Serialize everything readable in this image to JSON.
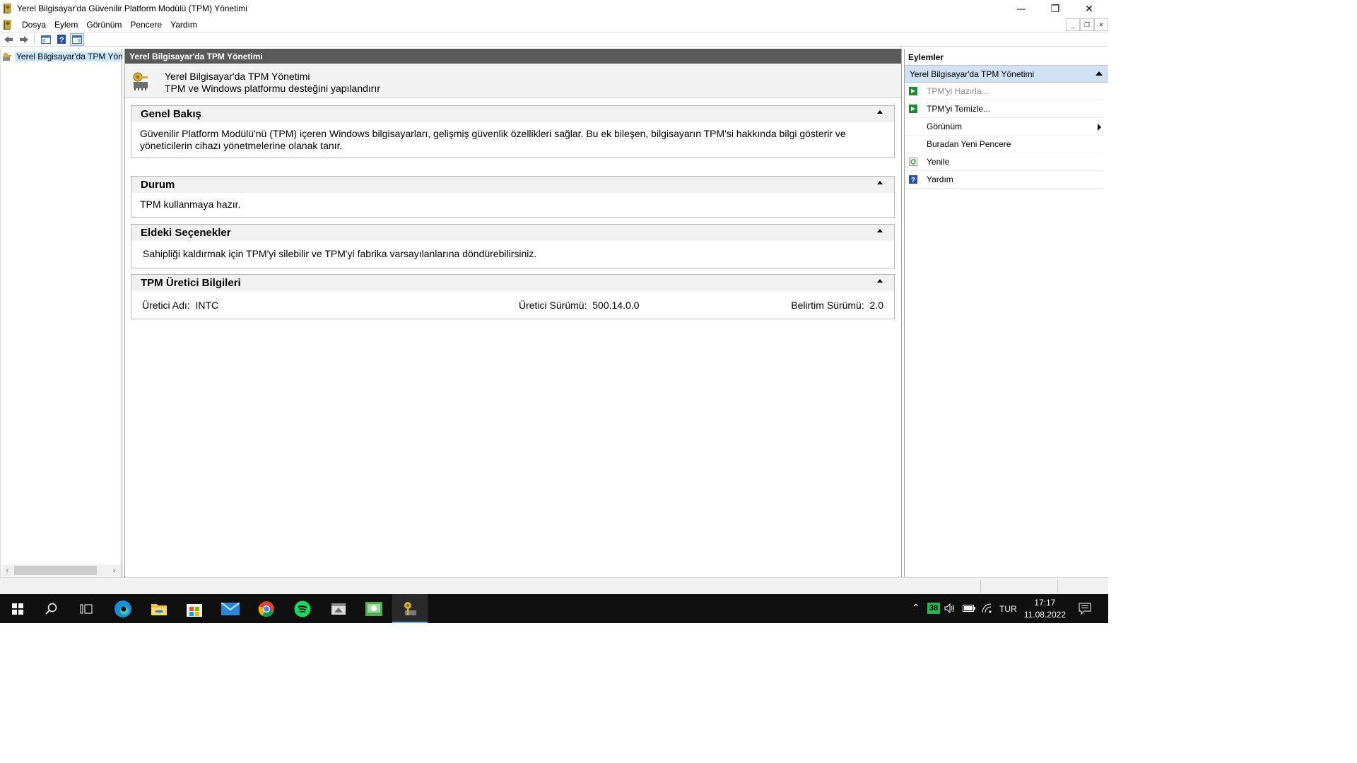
{
  "window": {
    "title": "Yerel Bilgisayar'da Güvenilir Platform Modülü (TPM) Yönetimi",
    "minimize_glyph": "—",
    "maximize_glyph": "❐",
    "close_glyph": "✕"
  },
  "menu": {
    "items": [
      "Dosya",
      "Eylem",
      "Görünüm",
      "Pencere",
      "Yardım"
    ]
  },
  "tree": {
    "root_label": "Yerel Bilgisayar'da TPM Yönetimi"
  },
  "center": {
    "header": "Yerel Bilgisayar'da TPM Yönetimi",
    "snapin_title": "Yerel Bilgisayar'da TPM Yönetimi",
    "snapin_subtitle": "TPM ve Windows platformu desteğini yapılandırır",
    "sections": {
      "overview": {
        "title": "Genel Bakış",
        "body": "Güvenilir Platform Modülü'nü (TPM) içeren Windows bilgisayarları, gelişmiş güvenlik özellikleri sağlar. Bu ek bileşen, bilgisayarın TPM'si hakkında bilgi gösterir ve yöneticilerin cihazı yönetmelerine olanak tanır."
      },
      "status": {
        "title": "Durum",
        "body": "TPM kullanmaya hazır."
      },
      "options": {
        "title": "Eldeki Seçenekler",
        "body": "Sahipliği kaldırmak için TPM'yi silebilir ve TPM'yi fabrika varsayılanlarına döndürebilirsiniz."
      },
      "manufacturer": {
        "title": "TPM Üretici Bilgileri",
        "name_label": "Üretici Adı:",
        "name_value": "INTC",
        "version_label": "Üretici Sürümü:",
        "version_value": "500.14.0.0",
        "spec_label": "Belirtim Sürümü:",
        "spec_value": "2.0"
      }
    }
  },
  "actions": {
    "title": "Eylemler",
    "group": "Yerel Bilgisayar'da TPM Yönetimi",
    "items": [
      {
        "label": "TPM'yi Hazırla...",
        "enabled": false,
        "icon": "green-arrow-icon"
      },
      {
        "label": "TPM'yi Temizle...",
        "enabled": true,
        "icon": "green-arrow-icon"
      },
      {
        "label": "Görünüm",
        "enabled": true,
        "icon": "none"
      },
      {
        "label": "Buradan Yeni Pencere",
        "enabled": true,
        "icon": "none"
      },
      {
        "label": "Yenile",
        "enabled": true,
        "icon": "refresh-icon"
      },
      {
        "label": "Yardım",
        "enabled": true,
        "icon": "help-icon"
      }
    ]
  },
  "taskbar": {
    "apps": [
      "start",
      "search",
      "task-view",
      "edge",
      "file-explorer",
      "microsoft-store",
      "mail",
      "chrome",
      "spotify",
      "app-window",
      "app-green",
      "tpm-management"
    ],
    "tray": {
      "badge": "38",
      "language": "TUR",
      "time": "17:17",
      "date": "11.08.2022"
    }
  },
  "colors": {
    "center_header_bg": "#5a5a5a",
    "actions_group_bg": "#cfe1f3",
    "tree_selection_bg": "#cce8ff",
    "taskbar_bg": "#101010"
  }
}
